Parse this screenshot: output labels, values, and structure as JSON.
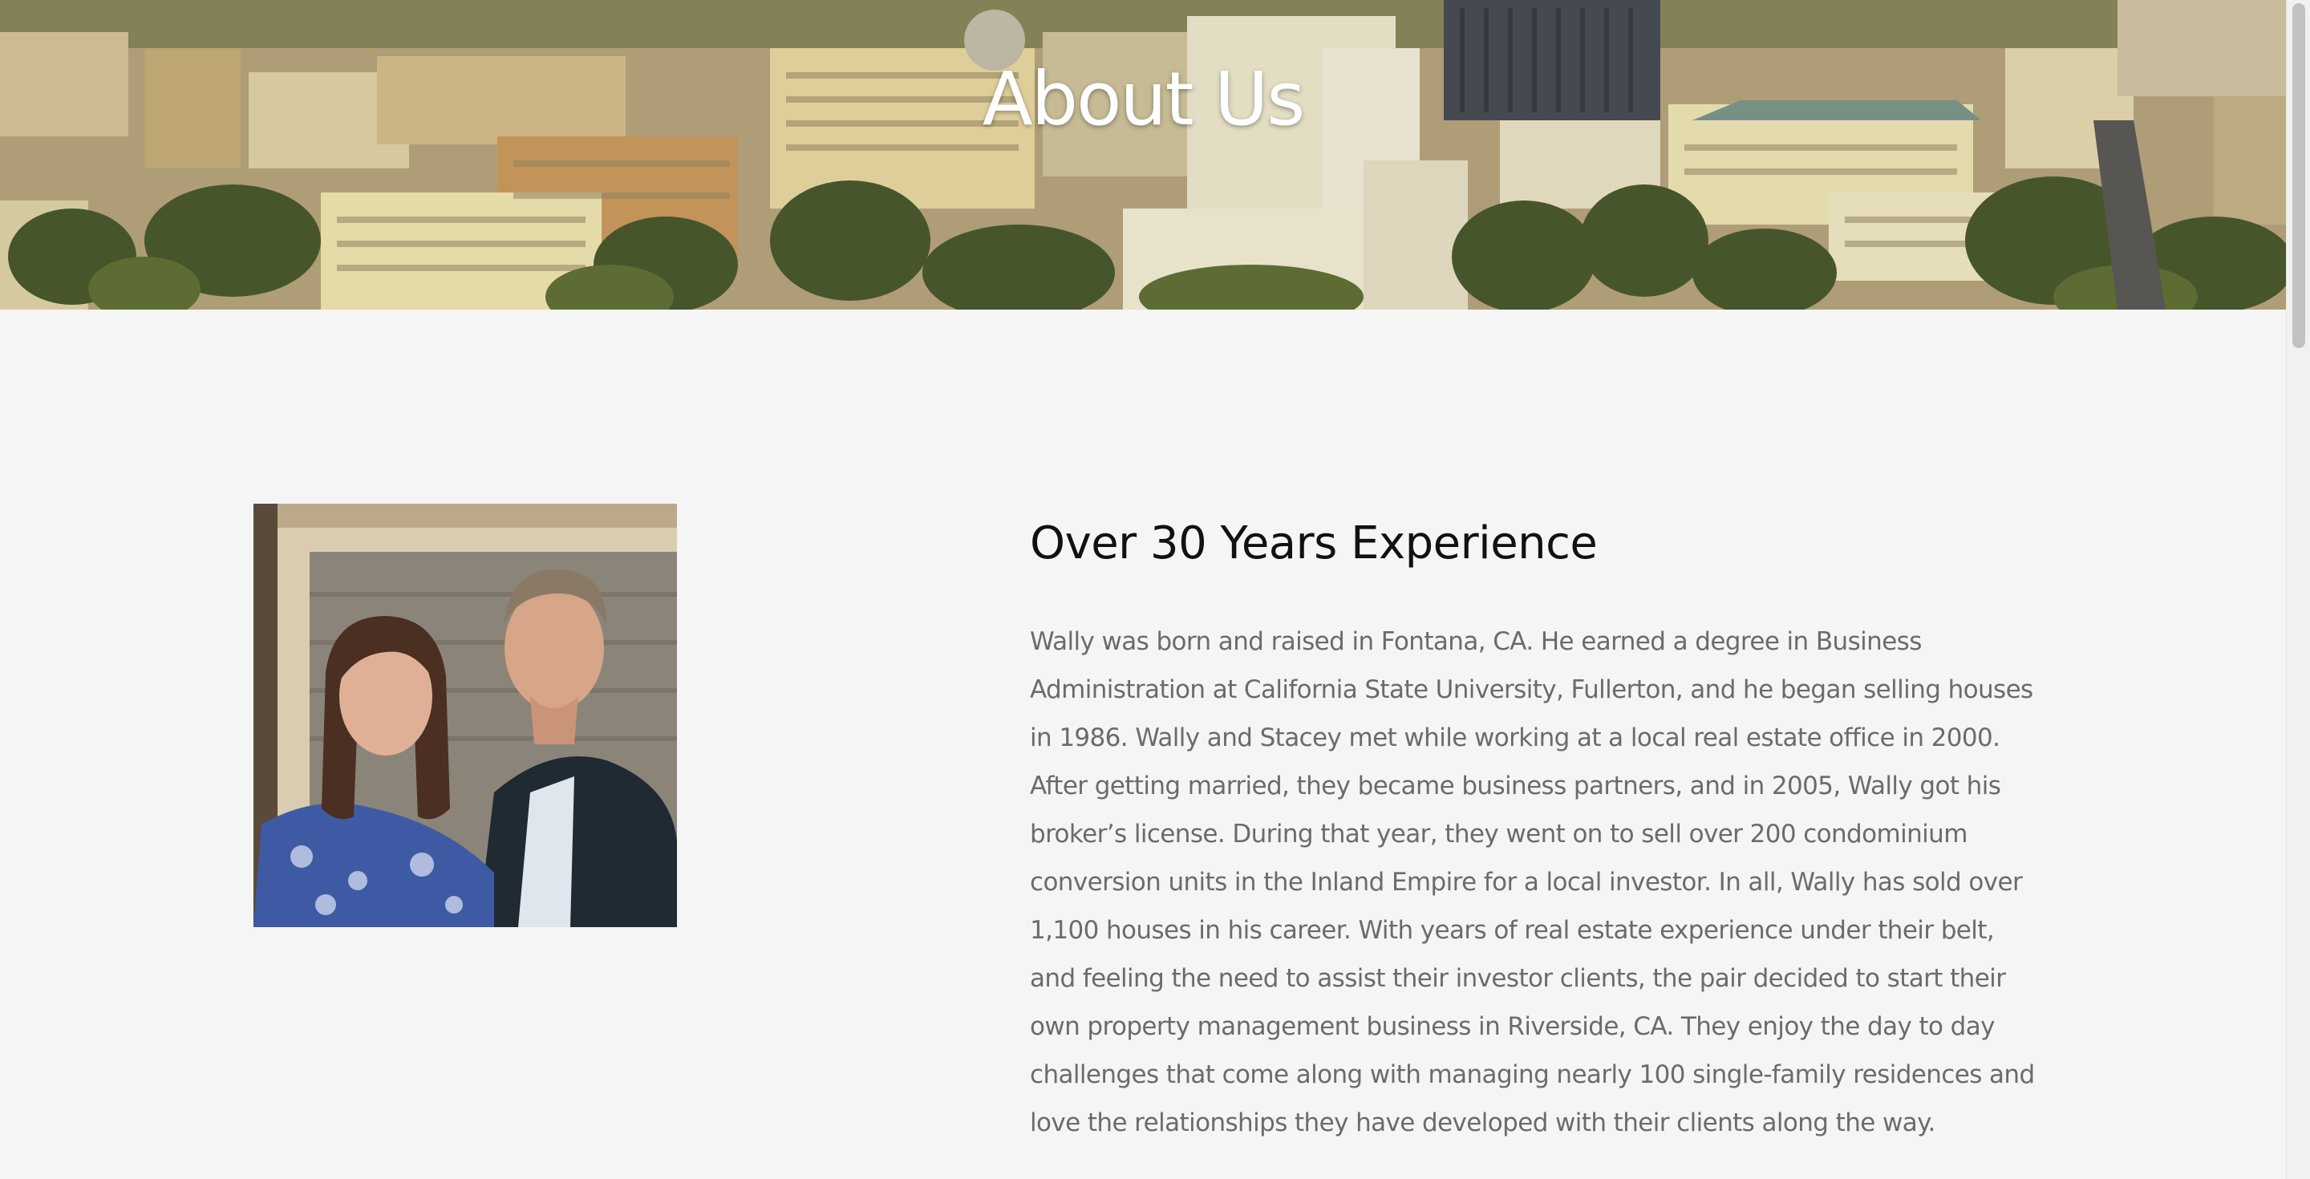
{
  "hero": {
    "title": "About Us",
    "image_description_icon": "city-skyline-image"
  },
  "about": {
    "heading": "Over 30 Years Experience",
    "bio": "Wally was born and raised in Fontana, CA. He earned a degree in Business Administration at California State University, Fullerton, and he began selling houses in 1986. Wally and Stacey met while working at a local real estate office in 2000. After getting married, they became business partners, and in 2005, Wally got his broker’s license. During that year, they went on to sell over 200 condominium conversion units in the Inland Empire for a local investor. In all, Wally has sold over 1,100 houses in his career. With years of real estate experience under their belt, and feeling the need to assist their investor clients, the pair decided to start their own property management business in Riverside, CA. They enjoy the day to day challenges that come along with managing nearly 100 single-family residences and love the relationships they have developed with their clients along the way.",
    "photo_icon": "owners-photo"
  },
  "colors": {
    "background": "#f5f5f5",
    "heading": "#111111",
    "body_text": "#6b6b6b",
    "hero_title": "#ffffff"
  }
}
